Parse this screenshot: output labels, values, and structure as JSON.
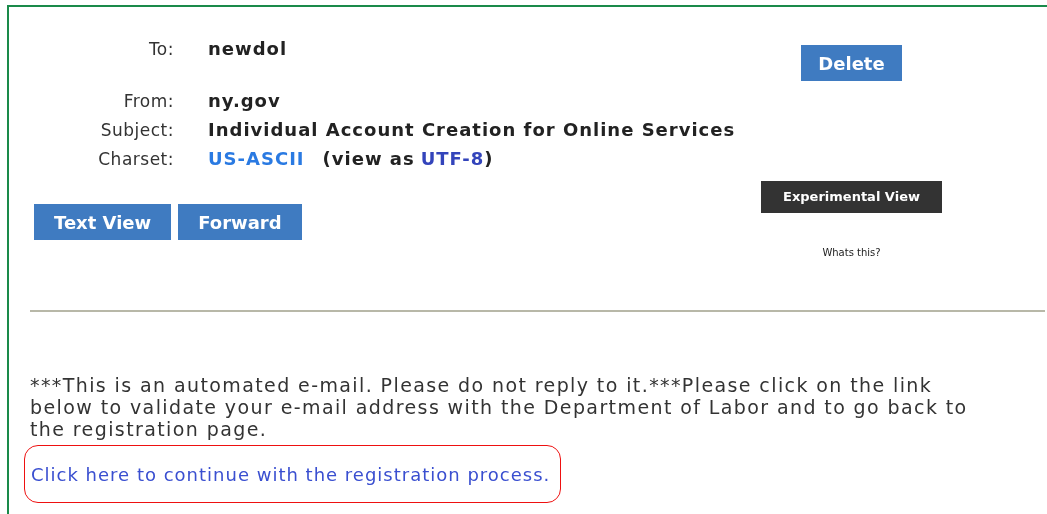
{
  "header": {
    "fields": [
      {
        "kind": "plain",
        "label": "To:",
        "value": "newdol"
      },
      {
        "kind": "plain",
        "label": "From:",
        "value": "ny.gov"
      },
      {
        "kind": "plain",
        "label": "Subject:",
        "value": "Individual Account Creation for Online Services"
      },
      {
        "kind": "charset",
        "label": "Charset:",
        "value": "US-ASCII",
        "view_as_prefix": "(view as",
        "view_as_link": "UTF-8",
        "view_as_suffix": ")"
      }
    ]
  },
  "buttons": [
    "Text View",
    "Forward"
  ],
  "delete_button": "Delete",
  "experimental_view_button": "Experimental View",
  "whats_this_link": "Whats this?",
  "body": {
    "text": "***This is an automated e-mail. Please do not reply to it.***Please click on the link below to validate your e-mail address with the Department of Labor and to go back to the registration page.",
    "link": "Click here to continue with the registration process.",
    "link_highlighted": true
  }
}
